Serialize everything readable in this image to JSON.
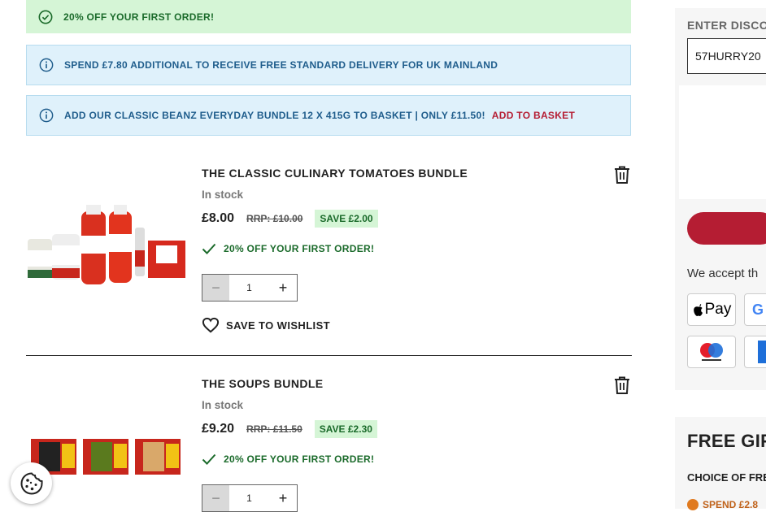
{
  "banners": {
    "first_order": "20% OFF YOUR FIRST ORDER!",
    "delivery": "SPEND £7.80 ADDITIONAL TO RECEIVE FREE STANDARD DELIVERY FOR UK MAINLAND",
    "bundle_offer": "ADD OUR CLASSIC BEANZ EVERYDAY BUNDLE 12 X 415G TO BASKET  | ONLY £11.50!",
    "add_to_basket": "ADD TO BASKET"
  },
  "products": [
    {
      "title": "THE CLASSIC CULINARY TOMATOES BUNDLE",
      "stock": "In stock",
      "price": "£8.00",
      "rrp": "RRP: £10.00",
      "save": "SAVE £2.00",
      "promo": "20% OFF YOUR FIRST ORDER!",
      "quantity": "1",
      "wishlist": "SAVE TO WISHLIST"
    },
    {
      "title": "THE SOUPS BUNDLE",
      "stock": "In stock",
      "price": "£9.20",
      "rrp": "RRP: £11.50",
      "save": "SAVE £2.30",
      "promo": "20% OFF YOUR FIRST ORDER!",
      "quantity": "1"
    }
  ],
  "sidebar": {
    "discount_label": "ENTER DISCO",
    "discount_code": "57HURRY20",
    "accept_text": "We accept th",
    "payment_methods": [
      "Apple Pay",
      "Google Pay",
      "Maestro",
      "Amex"
    ],
    "apple_pay_text": "Pay",
    "google_pay_text": "G",
    "free_gifts_title": "FREE GIFTS",
    "free_gifts_subtitle": "CHOICE OF FREE",
    "free_gifts_spend": "SPEND £2.8"
  },
  "colors": {
    "brand_red": "#b51d33",
    "success_green": "#1a6a2a",
    "info_blue": "#1f5d8c"
  },
  "icons": [
    "check-circle-icon",
    "info-icon",
    "trash-icon",
    "heart-icon",
    "checkmark-icon",
    "cookie-icon"
  ]
}
